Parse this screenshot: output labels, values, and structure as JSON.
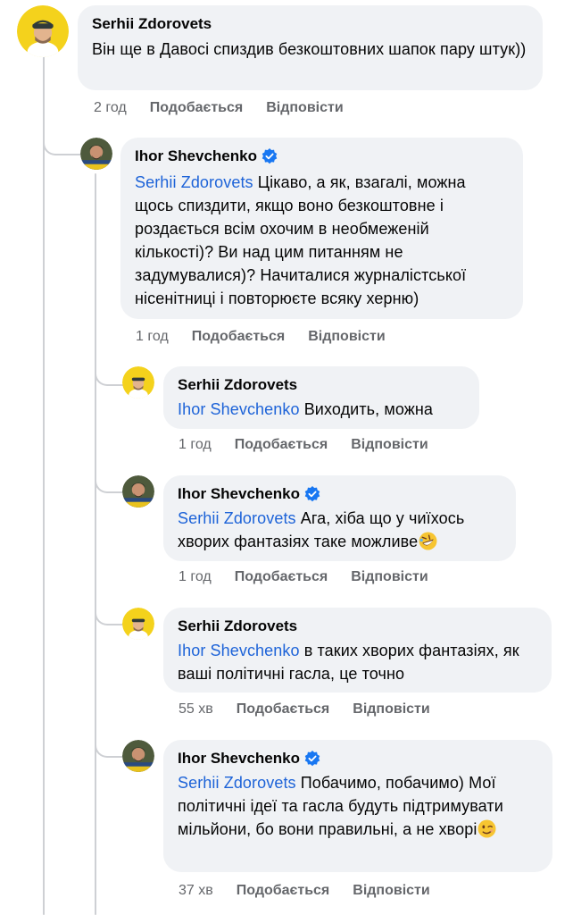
{
  "comments": [
    {
      "author": "Serhii Zdorovets",
      "verified": false,
      "mention": "",
      "text": "Він ще в Давосі спиздив безкоштовних шапок пару штук))",
      "time": "2 год",
      "like": "Подобається",
      "reply": "Відповісти"
    },
    {
      "author": "Ihor Shevchenko",
      "verified": true,
      "mention": "Serhii Zdorovets",
      "text": "Цікаво, а як, взагалі, можна щось спиздити, якщо воно безкоштовне і роздається всім охочим в необмеженій кількості)? Ви над цим питанням не задумувалися)? Начиталися журналістської нісенітниці і повторюєте всяку херню)",
      "time": "1 год",
      "like": "Подобається",
      "reply": "Відповісти"
    },
    {
      "author": "Serhii Zdorovets",
      "verified": false,
      "mention": "Ihor Shevchenko",
      "text": "Виходить, можна",
      "time": "1 год",
      "like": "Подобається",
      "reply": "Відповісти"
    },
    {
      "author": "Ihor Shevchenko",
      "verified": true,
      "mention": "Serhii Zdorovets",
      "text": "Ага, хіба що у чиїхось хворих фантазіях таке можливе",
      "emoji": "rofl-emoji",
      "time": "1 год",
      "like": "Подобається",
      "reply": "Відповісти"
    },
    {
      "author": "Serhii Zdorovets",
      "verified": false,
      "mention": "Ihor Shevchenko",
      "text": "в таких хворих фантазіях, як ваші політичні гасла, це точно",
      "time": "55 хв",
      "like": "Подобається",
      "reply": "Відповісти"
    },
    {
      "author": "Ihor Shevchenko",
      "verified": true,
      "mention": "Serhii Zdorovets",
      "text": "Побачимо, побачимо) Мої політичні ідеї та гасла будуть підтримувати мільйони, бо вони правильні, а не хворі",
      "emoji": "wink-emoji",
      "time": "37 хв",
      "like": "Подобається",
      "reply": "Відповісти"
    }
  ],
  "colors": {
    "mention": "#1d63d8",
    "bubble": "#f0f2f5",
    "meta": "#65676b",
    "verified": "#1877f2",
    "thread_line": "#ced0d4"
  },
  "icons": [
    "avatar-serhii",
    "avatar-ihor",
    "verified-badge-icon",
    "rofl-emoji",
    "wink-emoji"
  ]
}
